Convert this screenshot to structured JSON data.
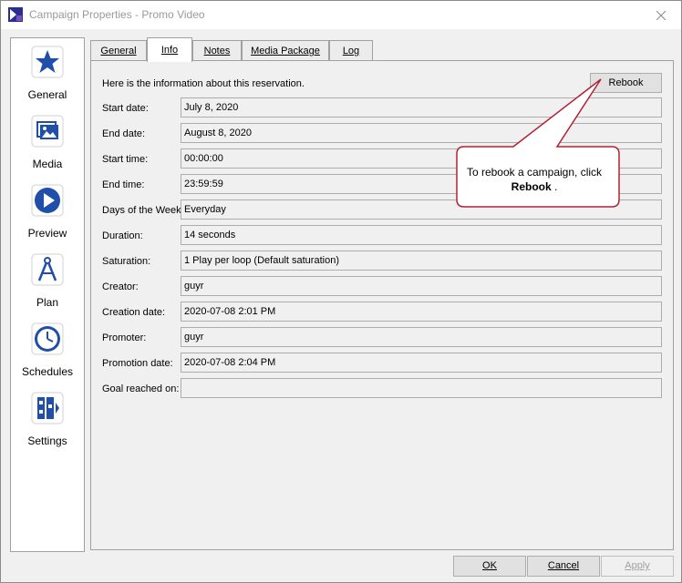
{
  "window": {
    "title": "Campaign Properties - Promo Video"
  },
  "nav": {
    "items": [
      {
        "label": "General",
        "icon": "star-icon"
      },
      {
        "label": "Media",
        "icon": "media-icon"
      },
      {
        "label": "Preview",
        "icon": "play-icon"
      },
      {
        "label": "Plan",
        "icon": "compass-icon"
      },
      {
        "label": "Schedules",
        "icon": "clock-icon"
      },
      {
        "label": "Settings",
        "icon": "settings-icon"
      }
    ]
  },
  "tabs": [
    "General",
    "Info",
    "Notes",
    "Media Package",
    "Log"
  ],
  "info": {
    "intro": "Here is the information about this reservation.",
    "rebook_label": "Rebook",
    "fields": [
      {
        "label": "Start date:",
        "value": "July 8, 2020"
      },
      {
        "label": "End date:",
        "value": "August 8, 2020"
      },
      {
        "label": "Start time:",
        "value": "00:00:00"
      },
      {
        "label": "End time:",
        "value": "23:59:59"
      },
      {
        "label": "Days of the Week:",
        "value": "Everyday"
      },
      {
        "label": "Duration:",
        "value": "14 seconds"
      },
      {
        "label": "Saturation:",
        "value": "1 Play per loop (Default saturation)"
      },
      {
        "label": "Creator:",
        "value": "guyr"
      },
      {
        "label": "Creation date:",
        "value": "2020-07-08 2:01 PM"
      },
      {
        "label": "Promoter:",
        "value": "guyr"
      },
      {
        "label": "Promotion date:",
        "value": "2020-07-08 2:04 PM"
      },
      {
        "label": "Goal reached on:",
        "value": ""
      }
    ]
  },
  "callout": {
    "text_before": "To rebook a campaign, click",
    "bold": "Rebook",
    "text_after": " ."
  },
  "footer": {
    "ok_label": "OK",
    "cancel_label": "Cancel",
    "apply_label": "Apply"
  },
  "colors": {
    "accent": "#1f4fa8",
    "callout_border": "#b22234"
  }
}
